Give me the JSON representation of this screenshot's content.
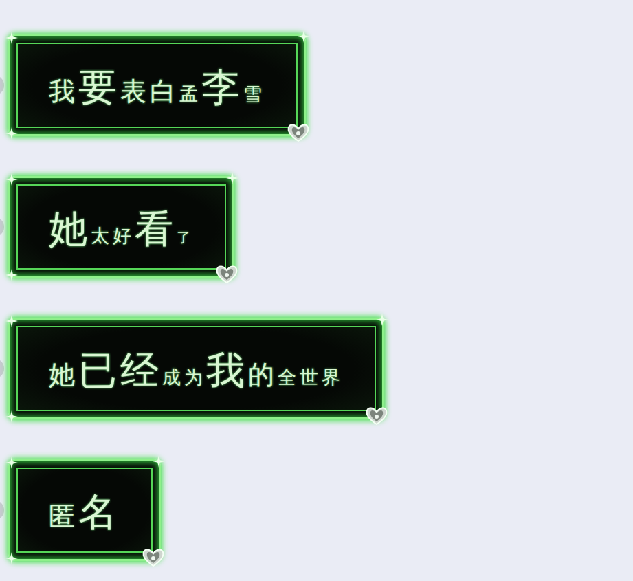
{
  "messages": [
    {
      "segments": [
        {
          "text": "我",
          "kind": "mid"
        },
        {
          "text": "要",
          "kind": "big"
        },
        {
          "text": "表白",
          "kind": "mid"
        },
        {
          "text": "孟",
          "kind": "small"
        },
        {
          "text": "李",
          "kind": "big"
        },
        {
          "text": "雪",
          "kind": "small"
        }
      ]
    },
    {
      "segments": [
        {
          "text": "她",
          "kind": "big"
        },
        {
          "text": "太好",
          "kind": "small"
        },
        {
          "text": "看",
          "kind": "big"
        },
        {
          "text": "了",
          "kind": "tiny"
        }
      ]
    },
    {
      "segments": [
        {
          "text": "她",
          "kind": "mid"
        },
        {
          "text": "已经",
          "kind": "big"
        },
        {
          "text": "成为",
          "kind": "small"
        },
        {
          "text": "我",
          "kind": "big"
        },
        {
          "text": "的",
          "kind": "mid"
        },
        {
          "text": "全世界",
          "kind": "small"
        }
      ]
    },
    {
      "segments": [
        {
          "text": "匿",
          "kind": "mid"
        },
        {
          "text": "名",
          "kind": "big"
        }
      ]
    }
  ]
}
